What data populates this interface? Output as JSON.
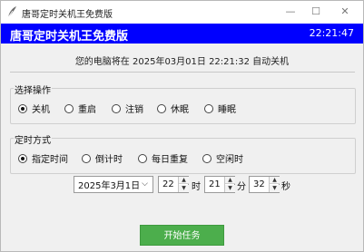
{
  "window": {
    "title": "唐哥定时关机王免费版",
    "min": "—",
    "max": "☐",
    "close": "✕"
  },
  "banner": {
    "title": "唐哥定时关机王免费版",
    "clock": "22:21:47"
  },
  "status": {
    "text": "您的电脑将在 2025年03月01日 22:21:32 自动关机"
  },
  "operation": {
    "label": "选择操作",
    "options": [
      "关机",
      "重启",
      "注销",
      "休眠",
      "睡眠"
    ],
    "selected": "关机"
  },
  "timing": {
    "label": "定时方式",
    "options": [
      "指定时间",
      "倒计时",
      "每日重复",
      "空闲时"
    ],
    "selected": "指定时间"
  },
  "picker": {
    "date": "2025年3月1日",
    "hour": "22",
    "minute": "21",
    "second": "32",
    "unit_hour": "时",
    "unit_minute": "分",
    "unit_second": "秒"
  },
  "start_button": {
    "label": "开始任务"
  },
  "colors": {
    "banner": "#0000ff",
    "start_button": "#4cae4c"
  },
  "icons": {
    "app": "feather-icon",
    "date_dropdown": "chevron-down-icon"
  }
}
